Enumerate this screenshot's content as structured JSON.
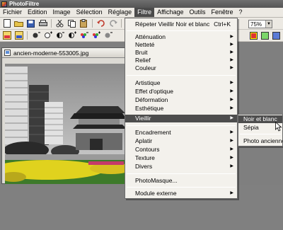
{
  "app": {
    "title": "PhotoFiltre"
  },
  "menubar": [
    "Fichier",
    "Edition",
    "Image",
    "Sélection",
    "Réglage",
    "Filtre",
    "Affichage",
    "Outils",
    "Fenêtre",
    "?"
  ],
  "toolbar": {
    "zoom_value": "75%"
  },
  "document": {
    "title": "ancien-moderne-553005.jpg"
  },
  "filtre_menu": {
    "repeat": {
      "label": "Répeter Vieillir Noir et blanc",
      "shortcut": "Ctrl+K"
    },
    "group1": [
      "Atténuation",
      "Netteté",
      "Bruit",
      "Relief",
      "Couleur"
    ],
    "group2": [
      "Artistique",
      "Effet d'optique",
      "Déformation",
      "Esthétique",
      "Vieillir"
    ],
    "group3": [
      "Encadrement",
      "Aplatir",
      "Contours",
      "Texture",
      "Divers"
    ],
    "photomasque": "PhotoMasque...",
    "module": "Module externe"
  },
  "submenu": [
    "Noir et blanc",
    "Sépia",
    "Photo ancienne..."
  ],
  "colors": {
    "menu_highlight": "#4d4d4d",
    "menu_bg": "#f3f1ec"
  }
}
